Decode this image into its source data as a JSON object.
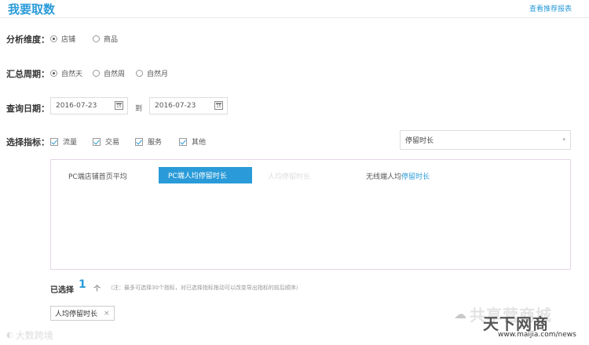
{
  "header": {
    "title": "我要取数",
    "link": "查看推荐报表"
  },
  "dimension": {
    "label": "分析维度：",
    "options": [
      {
        "label": "店铺",
        "checked": true
      },
      {
        "label": "商品",
        "checked": false
      }
    ]
  },
  "period": {
    "label": "汇总周期：",
    "options": [
      {
        "label": "自然天",
        "checked": true
      },
      {
        "label": "自然周",
        "checked": false
      },
      {
        "label": "自然月",
        "checked": false
      }
    ]
  },
  "date": {
    "label": "查询日期：",
    "start": "2016-07-23",
    "end": "2016-07-23",
    "to": "到",
    "calendar_day": "15"
  },
  "metrics": {
    "label": "选择指标：",
    "categories": [
      {
        "label": "流量",
        "checked": true
      },
      {
        "label": "交易",
        "checked": true
      },
      {
        "label": "服务",
        "checked": true
      },
      {
        "label": "其他",
        "checked": true
      }
    ],
    "search_value": "停留时长",
    "items": [
      {
        "label": "PC端店铺首页平均",
        "state": "normal"
      },
      {
        "label": "PC端人均停留时长",
        "state": "active"
      },
      {
        "label": "人均停留时长",
        "state": "faded"
      },
      {
        "label_prefix": "无线端人均",
        "label_highlight": "停留时长",
        "state": "normal"
      }
    ]
  },
  "selected": {
    "label": "已选择",
    "count": "1",
    "unit": "个",
    "note": "（注：最多可选择30个指标，对已选择指标拖动可以改变导出指标的前后顺序）",
    "tags": [
      {
        "label": "人均停留时长"
      }
    ]
  },
  "watermarks": {
    "left": "大数跨境",
    "right_brand": "共享营商城",
    "right_overlay": "天下网商",
    "url": "www.maijia.com/news"
  },
  "colors": {
    "accent": "#2a9bd8"
  }
}
